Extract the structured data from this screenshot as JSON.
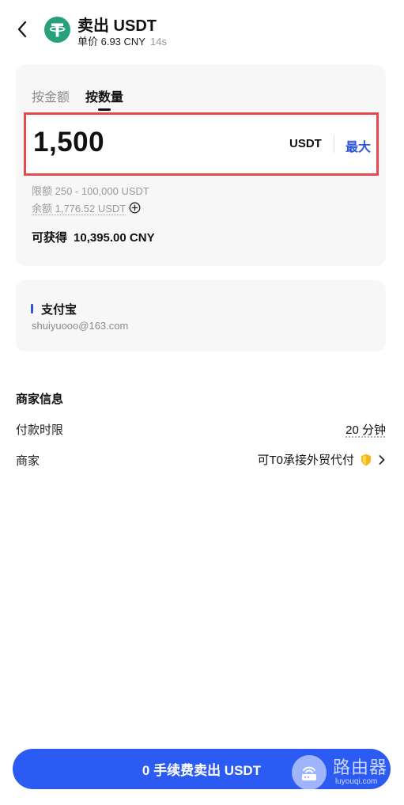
{
  "header": {
    "title": "卖出 USDT",
    "price_label": "单价 6.93 CNY",
    "timer": "14s"
  },
  "tabs": {
    "by_amount": "按金额",
    "by_quantity": "按数量"
  },
  "input": {
    "value": "1,500",
    "unit": "USDT",
    "max_label": "最大"
  },
  "limits": {
    "range": "限额 250 - 100,000 USDT",
    "balance": "余额 1,776.52 USDT"
  },
  "receive": {
    "label": "可获得",
    "amount": "10,395.00 CNY"
  },
  "payment": {
    "method": "支付宝",
    "account": "shuiyuooo@163.com"
  },
  "merchant": {
    "section_title": "商家信息",
    "payment_window_label": "付款时限",
    "payment_window_value": "20 分钟",
    "merchant_label": "商家",
    "merchant_name": "可T0承接外贸代付"
  },
  "action": {
    "sell_label": "0 手续费卖出 USDT"
  },
  "watermark": {
    "name": "路由器",
    "domain": "luyouqi.com"
  },
  "colors": {
    "accent": "#2c5bf3",
    "tether_green": "#26A17B",
    "highlight_border": "#e5484d"
  },
  "icons": {
    "back": "chevron-left-icon",
    "coin": "tether-icon",
    "balance_add": "plus-circle-icon",
    "verified": "shield-icon",
    "merchant_arrow": "chevron-right-icon"
  }
}
